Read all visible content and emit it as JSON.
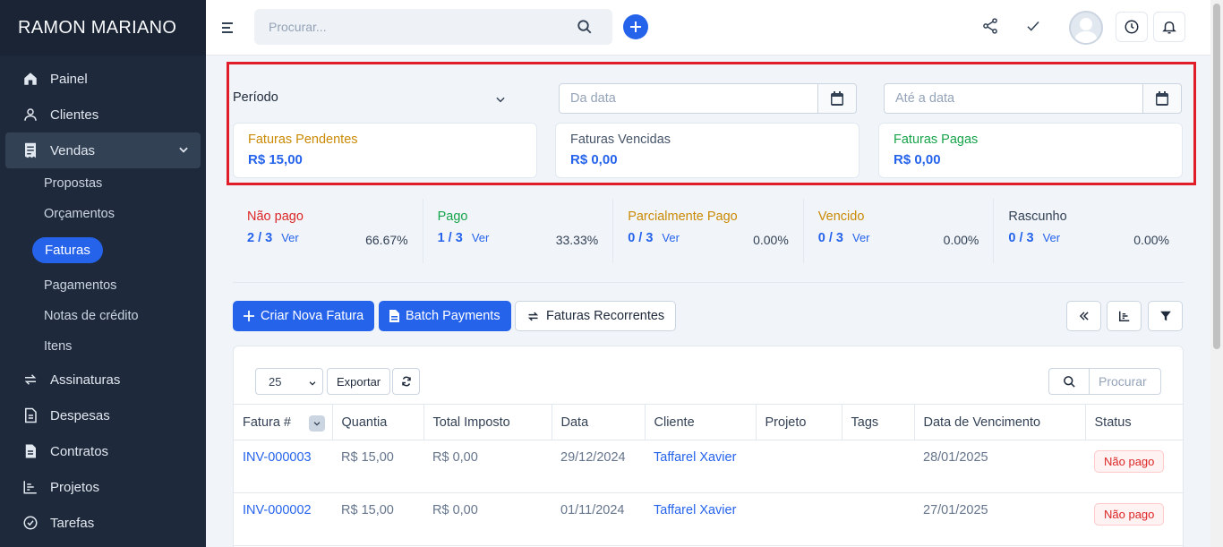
{
  "sidebar": {
    "brand": "RAMON MARIANO",
    "items": [
      {
        "label": "Painel",
        "icon": "home-icon"
      },
      {
        "label": "Clientes",
        "icon": "user-icon"
      },
      {
        "label": "Vendas",
        "icon": "receipt-icon"
      },
      {
        "label": "Assinaturas",
        "icon": "repeat-icon"
      },
      {
        "label": "Despesas",
        "icon": "file-text-icon"
      },
      {
        "label": "Contratos",
        "icon": "contract-icon"
      },
      {
        "label": "Projetos",
        "icon": "chart-icon"
      },
      {
        "label": "Tarefas",
        "icon": "check-circle-icon"
      }
    ],
    "sub_items": [
      "Propostas",
      "Orçamentos",
      "Faturas",
      "Pagamentos",
      "Notas de crédito",
      "Itens"
    ],
    "active_sub": "Faturas",
    "active_color": "#2563eb"
  },
  "header": {
    "search_placeholder": "Procurar..."
  },
  "filters": {
    "period_label": "Período",
    "from_placeholder": "Da data",
    "to_placeholder": "Até a data"
  },
  "summary": [
    {
      "title": "Faturas Pendentes",
      "value": "R$ 15,00",
      "color": "#ca8a04"
    },
    {
      "title": "Faturas Vencidas",
      "value": "R$ 0,00",
      "color": "#475569"
    },
    {
      "title": "Faturas Pagas",
      "value": "R$ 0,00",
      "color": "#16a34a"
    }
  ],
  "stats": [
    {
      "title": "Não pago",
      "count": "2 / 3",
      "link": "Ver",
      "pct": "66.67%",
      "color": "#dc2626"
    },
    {
      "title": "Pago",
      "count": "1 / 3",
      "link": "Ver",
      "pct": "33.33%",
      "color": "#16a34a"
    },
    {
      "title": "Parcialmente Pago",
      "count": "0 / 3",
      "link": "Ver",
      "pct": "0.00%",
      "color": "#ca8a04"
    },
    {
      "title": "Vencido",
      "count": "0 / 3",
      "link": "Ver",
      "pct": "0.00%",
      "color": "#ca8a04"
    },
    {
      "title": "Rascunho",
      "count": "0 / 3",
      "link": "Ver",
      "pct": "0.00%",
      "color": "#334155"
    }
  ],
  "actions": {
    "new_invoice": "Criar Nova Fatura",
    "batch_payments": "Batch Payments",
    "recurring": "Faturas Recorrentes"
  },
  "table": {
    "per_page": "25",
    "export": "Exportar",
    "search_placeholder": "Procurar",
    "columns": [
      "Fatura #",
      "Quantia",
      "Total Imposto",
      "Data",
      "Cliente",
      "Projeto",
      "Tags",
      "Data de Vencimento",
      "Status"
    ],
    "rows": [
      {
        "invoice": "INV-000003",
        "amount": "R$ 15,00",
        "tax": "R$ 0,00",
        "date": "29/12/2024",
        "client": "Taffarel Xavier",
        "project": "",
        "tags": "",
        "due": "28/01/2025",
        "status": "Não pago"
      },
      {
        "invoice": "INV-000002",
        "amount": "R$ 15,00",
        "tax": "R$ 0,00",
        "date": "01/11/2024",
        "client": "Taffarel Xavier",
        "project": "",
        "tags": "",
        "due": "27/01/2025",
        "status": "Não pago"
      }
    ]
  }
}
